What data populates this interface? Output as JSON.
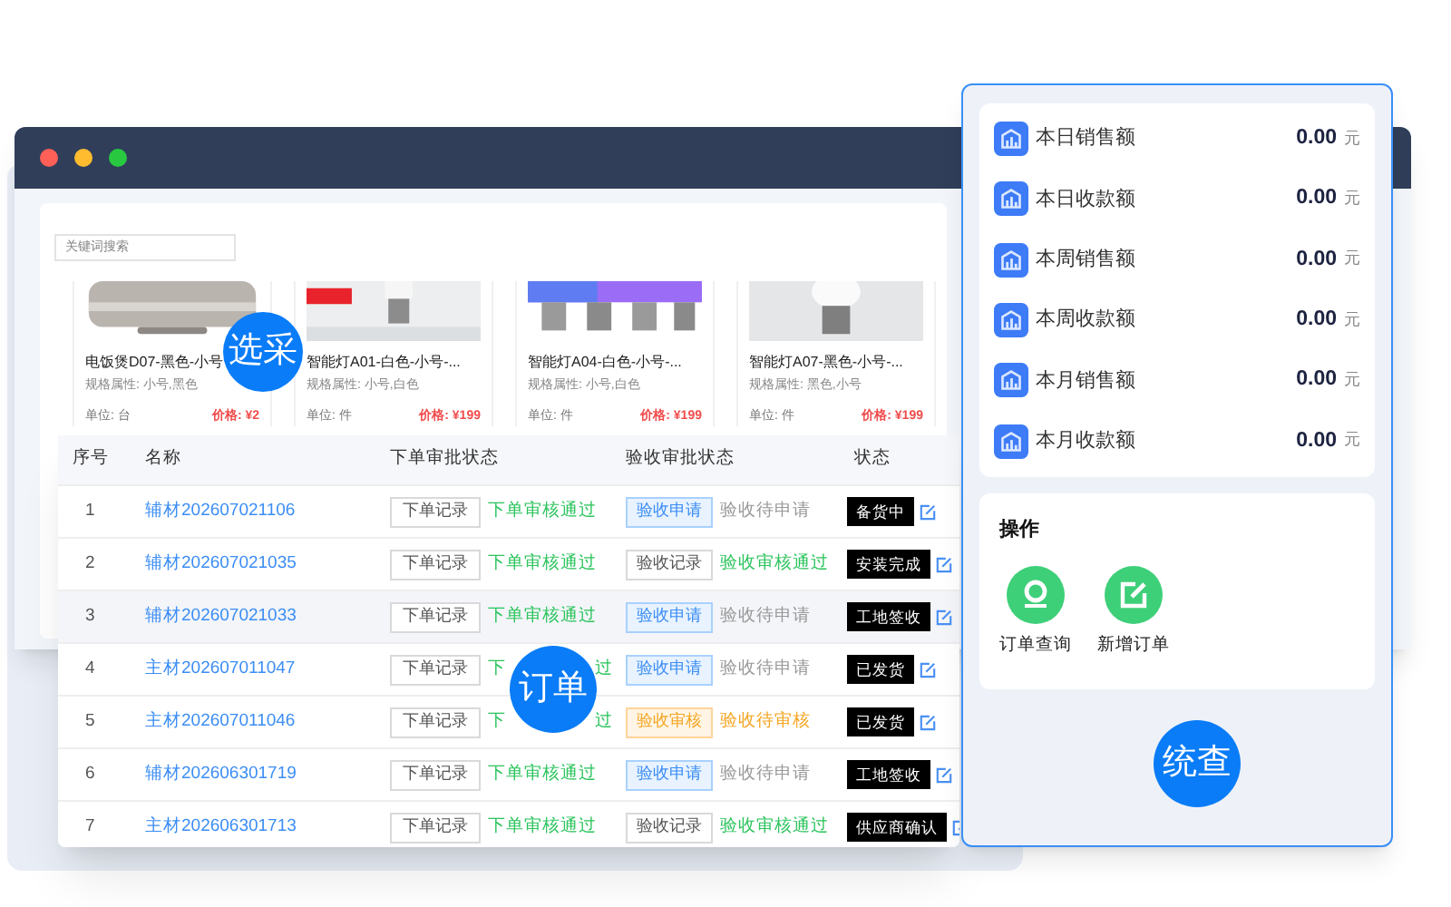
{
  "search": {
    "placeholder": "关键词搜索"
  },
  "products": [
    {
      "title": "电饭煲D07-黑色-小号",
      "spec": "规格属性: 小号,黑色",
      "unit": "单位: 台",
      "price": "价格: ¥2"
    },
    {
      "title": "智能灯A01-白色-小号-...",
      "spec": "规格属性: 小号,白色",
      "unit": "单位: 件",
      "price": "价格: ¥199"
    },
    {
      "title": "智能灯A04-白色-小号-...",
      "spec": "规格属性: 小号,白色",
      "unit": "单位: 件",
      "price": "价格: ¥199"
    },
    {
      "title": "智能灯A07-黑色-小号-...",
      "spec": "规格属性: 黑色,小号",
      "unit": "单位: 件",
      "price": "价格: ¥199"
    }
  ],
  "badges": [
    "选采",
    "订单",
    "统查"
  ],
  "table": {
    "columns": [
      "序号",
      "名称",
      "下单审批状态",
      "验收审批状态",
      "状态"
    ],
    "rows": [
      {
        "index": "1",
        "name": "辅材202607021106",
        "order_button": "下单记录",
        "order_status": "下单审核通过",
        "acceptance": {
          "kind": "apply",
          "button": "验收申请",
          "status": "验收待申请"
        },
        "status": "备货中",
        "selected": false
      },
      {
        "index": "2",
        "name": "辅材202607021035",
        "order_button": "下单记录",
        "order_status": "下单审核通过",
        "acceptance": {
          "kind": "record",
          "button": "验收记录",
          "status": "验收审核通过"
        },
        "status": "安装完成",
        "selected": false
      },
      {
        "index": "3",
        "name": "辅材202607021033",
        "order_button": "下单记录",
        "order_status": "下单审核通过",
        "acceptance": {
          "kind": "apply",
          "button": "验收申请",
          "status": "验收待申请"
        },
        "status": "工地签收",
        "selected": true
      },
      {
        "index": "4",
        "name": "主材202607011047",
        "order_button": "下单记录",
        "order_status": "下",
        "order_status_end": "过",
        "acceptance": {
          "kind": "apply",
          "button": "验收申请",
          "status": "验收待申请"
        },
        "status": "已发货",
        "selected": false
      },
      {
        "index": "5",
        "name": "主材202607011046",
        "order_button": "下单记录",
        "order_status": "下",
        "order_status_end": "过",
        "acceptance": {
          "kind": "review",
          "button": "验收审核",
          "status": "验收待审核"
        },
        "status": "已发货",
        "selected": false
      },
      {
        "index": "6",
        "name": "辅材202606301719",
        "order_button": "下单记录",
        "order_status": "下单审核通过",
        "acceptance": {
          "kind": "apply",
          "button": "验收申请",
          "status": "验收待申请"
        },
        "status": "工地签收",
        "selected": false
      },
      {
        "index": "7",
        "name": "主材202606301713",
        "order_button": "下单记录",
        "order_status": "下单审核通过",
        "acceptance": {
          "kind": "record",
          "button": "验收记录",
          "status": "验收审核通过"
        },
        "status": "供应商确认",
        "selected": false
      }
    ]
  },
  "stats": [
    {
      "label": "本日销售额",
      "value": "0.00",
      "unit": "元"
    },
    {
      "label": "本日收款额",
      "value": "0.00",
      "unit": "元"
    },
    {
      "label": "本周销售额",
      "value": "0.00",
      "unit": "元"
    },
    {
      "label": "本周收款额",
      "value": "0.00",
      "unit": "元"
    },
    {
      "label": "本月销售额",
      "value": "0.00",
      "unit": "元"
    },
    {
      "label": "本月收款额",
      "value": "0.00",
      "unit": "元"
    }
  ],
  "actions": {
    "title": "操作",
    "items": [
      {
        "kind": "search",
        "label": "订单查询"
      },
      {
        "kind": "add",
        "label": "新增订单"
      }
    ]
  }
}
